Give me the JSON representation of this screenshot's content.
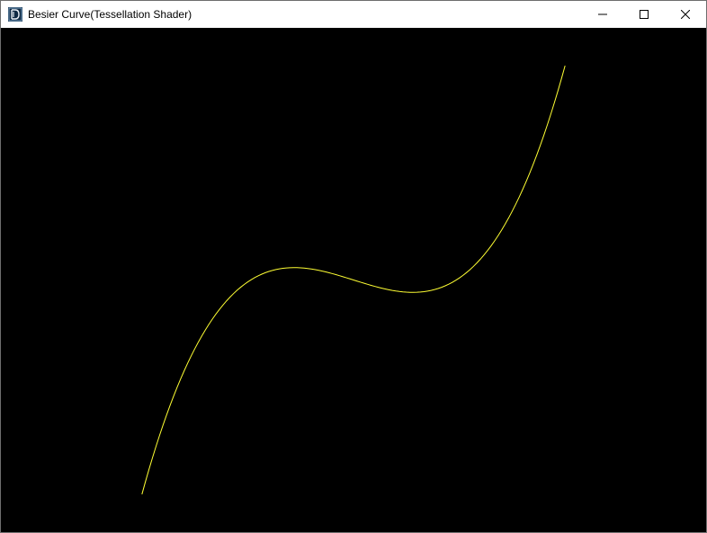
{
  "window": {
    "title": "Besier Curve(Tessellation Shader)",
    "icon": "opengl-app-icon",
    "controls": {
      "minimize": "minimize-icon",
      "maximize": "maximize-icon",
      "close": "close-icon"
    }
  },
  "canvas": {
    "background": "#000000",
    "curve_color": "#ffff33",
    "control_points_ndc": [
      [
        -0.6,
        -0.85
      ],
      [
        -0.2,
        1.2
      ],
      [
        0.2,
        -1.2
      ],
      [
        0.6,
        0.85
      ]
    ]
  }
}
